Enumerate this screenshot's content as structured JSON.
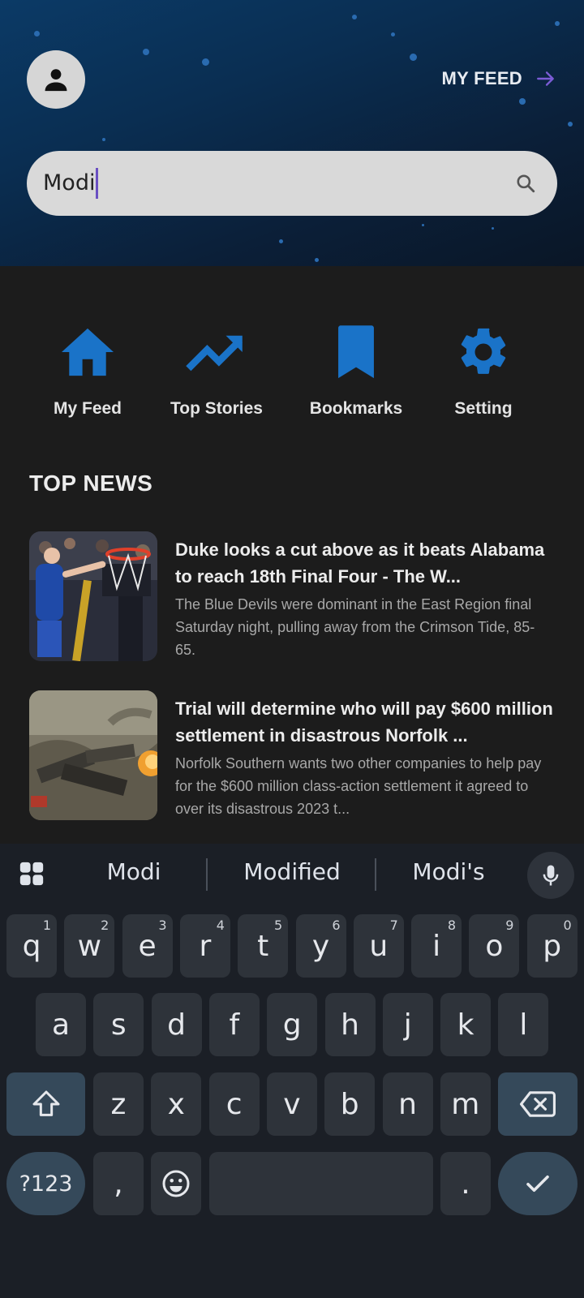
{
  "header": {
    "myfeed_label": "MY FEED",
    "search_value": "Modi",
    "accent": "#7b5cd6"
  },
  "nav": {
    "items": [
      {
        "label": "My Feed",
        "icon": "home-icon"
      },
      {
        "label": "Top Stories",
        "icon": "trending-up-icon"
      },
      {
        "label": "Bookmarks",
        "icon": "bookmark-icon"
      },
      {
        "label": "Setting",
        "icon": "gear-icon"
      }
    ],
    "icon_color": "#1a73c8"
  },
  "section_title": "TOP NEWS",
  "news": [
    {
      "title": "Duke looks a cut above as it beats Alabama to reach 18th Final Four - The W...",
      "description": "The Blue Devils were dominant in the East Region final Saturday night, pulling away from the Crimson Tide, 85-65."
    },
    {
      "title": "Trial will determine who will pay $600 million settlement in disastrous Norfolk ...",
      "description": "Norfolk Southern wants two other companies to help pay for the $600 million class-action settlement it agreed to over its disastrous 2023 t..."
    }
  ],
  "keyboard": {
    "suggestions": [
      "Modi",
      "Modified",
      "Modi's"
    ],
    "row1": [
      {
        "k": "q",
        "h": "1"
      },
      {
        "k": "w",
        "h": "2"
      },
      {
        "k": "e",
        "h": "3"
      },
      {
        "k": "r",
        "h": "4"
      },
      {
        "k": "t",
        "h": "5"
      },
      {
        "k": "y",
        "h": "6"
      },
      {
        "k": "u",
        "h": "7"
      },
      {
        "k": "i",
        "h": "8"
      },
      {
        "k": "o",
        "h": "9"
      },
      {
        "k": "p",
        "h": "0"
      }
    ],
    "row2": [
      "a",
      "s",
      "d",
      "f",
      "g",
      "h",
      "j",
      "k",
      "l"
    ],
    "row3": [
      "z",
      "x",
      "c",
      "v",
      "b",
      "n",
      "m"
    ],
    "symbols_label": "?123",
    "comma_label": ",",
    "period_label": "."
  }
}
